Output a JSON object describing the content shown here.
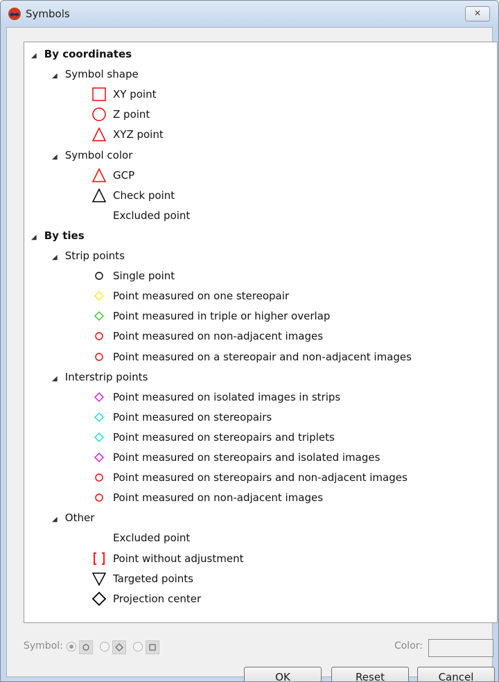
{
  "window": {
    "title": "Symbols",
    "close_label": "✕"
  },
  "tree": [
    {
      "label": "By coordinates",
      "level": 0,
      "expanded": true
    },
    {
      "label": "Symbol shape",
      "level": 1,
      "expanded": true
    },
    {
      "label": "XY point",
      "level": 2,
      "symbol": "square",
      "color": "#ff0000"
    },
    {
      "label": "Z point",
      "level": 2,
      "symbol": "circle",
      "color": "#ff0000"
    },
    {
      "label": "XYZ point",
      "level": 2,
      "symbol": "triangle",
      "color": "#ff0000"
    },
    {
      "label": "Symbol color",
      "level": 1,
      "expanded": true
    },
    {
      "label": "GCP",
      "level": 2,
      "symbol": "triangle",
      "color": "#ff0000"
    },
    {
      "label": "Check point",
      "level": 2,
      "symbol": "triangle",
      "color": "#000000"
    },
    {
      "label": "Excluded point",
      "level": 2,
      "symbol": "none"
    },
    {
      "label": "By ties",
      "level": 0,
      "expanded": true
    },
    {
      "label": "Strip points",
      "level": 1,
      "expanded": true
    },
    {
      "label": "Single point",
      "level": 2,
      "symbol": "small-circle",
      "color": "#000000"
    },
    {
      "label": "Point measured on one stereopair",
      "level": 2,
      "symbol": "small-diamond",
      "color": "#ffe600"
    },
    {
      "label": "Point measured in triple or higher overlap",
      "level": 2,
      "symbol": "small-diamond",
      "color": "#22c022"
    },
    {
      "label": "Point measured on non-adjacent images",
      "level": 2,
      "symbol": "small-circle",
      "color": "#ff0000"
    },
    {
      "label": "Point measured on a stereopair and non-adjacent images",
      "level": 2,
      "symbol": "small-circle",
      "color": "#ff0000"
    },
    {
      "label": "Interstrip points",
      "level": 1,
      "expanded": true
    },
    {
      "label": "Point measured on isolated images in strips",
      "level": 2,
      "symbol": "small-diamond",
      "color": "#e000e0"
    },
    {
      "label": "Point measured on stereopairs",
      "level": 2,
      "symbol": "small-diamond",
      "color": "#00d8e8"
    },
    {
      "label": "Point measured on stereopairs and triplets",
      "level": 2,
      "symbol": "small-diamond",
      "color": "#00d8e8"
    },
    {
      "label": "Point measured on stereopairs and isolated images",
      "level": 2,
      "symbol": "small-diamond",
      "color": "#e000e0"
    },
    {
      "label": "Point measured on stereopairs and non-adjacent images",
      "level": 2,
      "symbol": "small-circle",
      "color": "#ff0000"
    },
    {
      "label": "Point measured on non-adjacent images",
      "level": 2,
      "symbol": "small-circle",
      "color": "#ff0000"
    },
    {
      "label": "Other",
      "level": 1,
      "expanded": true
    },
    {
      "label": "Excluded point",
      "level": 2,
      "symbol": "none"
    },
    {
      "label": "Point without adjustment",
      "level": 2,
      "symbol": "brackets",
      "color": "#ff0000"
    },
    {
      "label": "Targeted points",
      "level": 2,
      "symbol": "down-triangle",
      "color": "#000000"
    },
    {
      "label": "Projection center",
      "level": 2,
      "symbol": "diamond",
      "color": "#000000"
    }
  ],
  "bottom": {
    "symbol_label": "Symbol:",
    "color_label": "Color:",
    "symbol_options": [
      "circle-icon",
      "diamond-icon",
      "square-icon"
    ]
  },
  "buttons": {
    "ok": "OK",
    "reset": "Reset",
    "cancel": "Cancel"
  }
}
